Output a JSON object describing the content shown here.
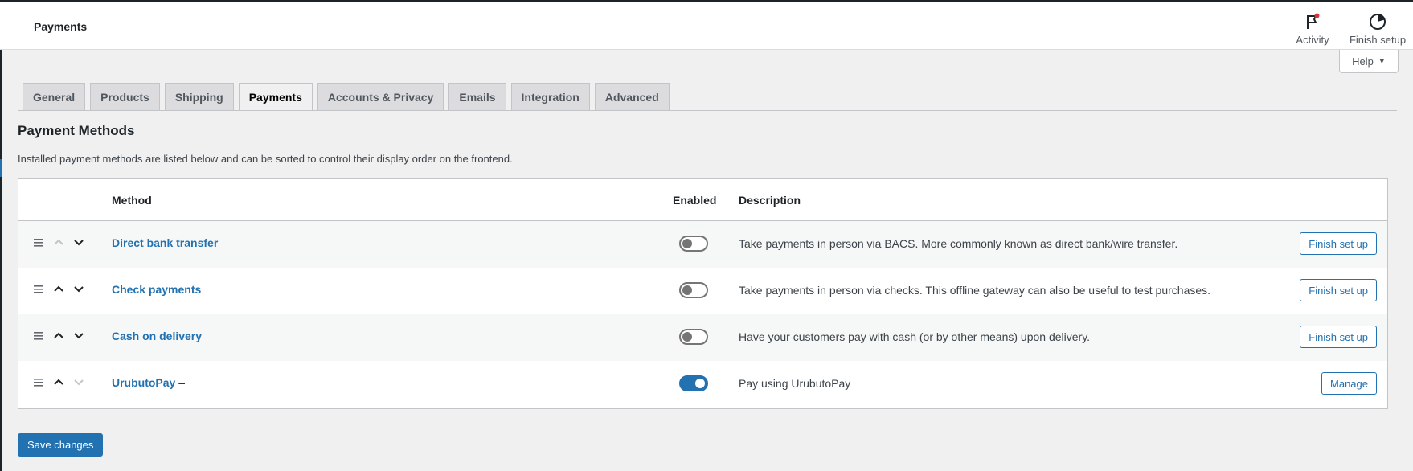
{
  "header": {
    "title": "Payments",
    "activity_label": "Activity",
    "finish_setup_label": "Finish setup"
  },
  "help": {
    "label": "Help"
  },
  "tabs": [
    {
      "label": "General"
    },
    {
      "label": "Products"
    },
    {
      "label": "Shipping"
    },
    {
      "label": "Payments",
      "active": true
    },
    {
      "label": "Accounts & Privacy"
    },
    {
      "label": "Emails"
    },
    {
      "label": "Integration"
    },
    {
      "label": "Advanced"
    }
  ],
  "section": {
    "title": "Payment Methods",
    "description": "Installed payment methods are listed below and can be sorted to control their display order on the frontend."
  },
  "table": {
    "columns": {
      "method": "Method",
      "enabled": "Enabled",
      "description": "Description"
    },
    "rows": [
      {
        "method": "Direct bank transfer",
        "suffix": "",
        "enabled": false,
        "description": "Take payments in person via BACS. More commonly known as direct bank/wire transfer.",
        "action": "Finish set up"
      },
      {
        "method": "Check payments",
        "suffix": "",
        "enabled": false,
        "description": "Take payments in person via checks. This offline gateway can also be useful to test purchases.",
        "action": "Finish set up"
      },
      {
        "method": "Cash on delivery",
        "suffix": "",
        "enabled": false,
        "description": "Have your customers pay with cash (or by other means) upon delivery.",
        "action": "Finish set up"
      },
      {
        "method": "UrubutoPay",
        "suffix": " –",
        "enabled": true,
        "description": "Pay using UrubutoPay",
        "action": "Manage"
      }
    ]
  },
  "footer": {
    "save_label": "Save changes"
  },
  "colors": {
    "accent": "#2271b1",
    "toggle_off": "#757575",
    "notification_dot": "#d63638"
  }
}
